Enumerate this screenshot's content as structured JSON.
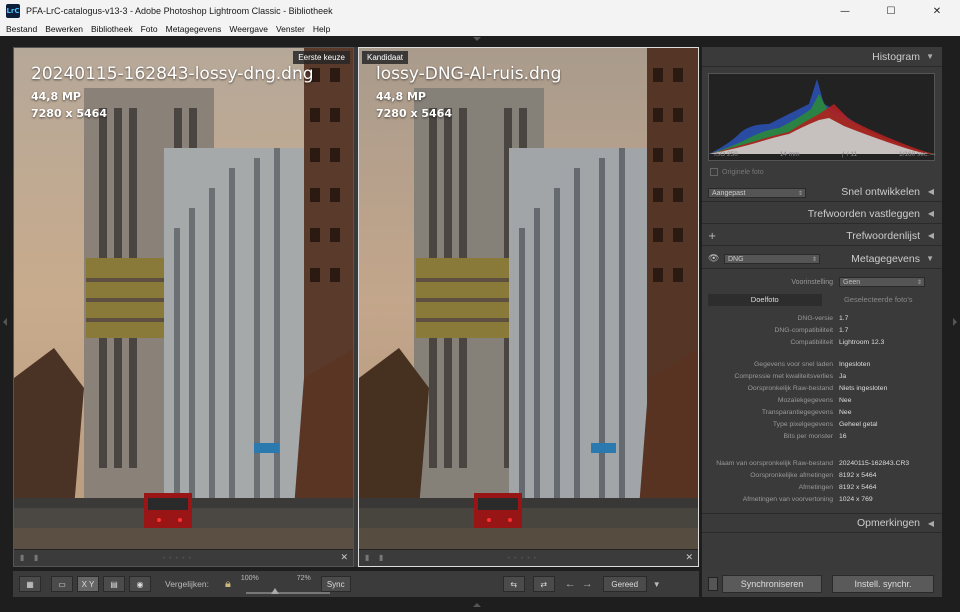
{
  "window": {
    "app_icon": "LrC",
    "title": "PFA-LrC-catalogus-v13-3 - Adobe Photoshop Lightroom Classic - Bibliotheek",
    "minimize": "—",
    "maximize": "☐",
    "close": "✕"
  },
  "menu": [
    "Bestand",
    "Bewerken",
    "Bibliotheek",
    "Foto",
    "Metagegevens",
    "Weergave",
    "Venster",
    "Help"
  ],
  "compare": {
    "left": {
      "label": "Eerste keuze",
      "filename": "20240115-162843-lossy-dng.dng",
      "megapixels": "44,8 MP",
      "dimensions": "7280 x 5464"
    },
    "right": {
      "label": "Kandidaat",
      "filename": "lossy-DNG-AI-ruis.dng",
      "megapixels": "44,8 MP",
      "dimensions": "7280 x 5464"
    }
  },
  "toolbar": {
    "compare_label": "Vergelijken:",
    "zoom_min": "100%",
    "zoom_max": "72%",
    "zoom_level": 0.35,
    "sync_label": "Sync",
    "done_label": "Gereed",
    "xy_label": "X Y"
  },
  "right_panel": {
    "histogram": {
      "title": "Histogram",
      "iso": "ISO 250",
      "focal": "14 mm",
      "aperture": "ƒ / 11",
      "shutter": "1/160 sec.",
      "original_photo": "Originele foto"
    },
    "quick_develop": {
      "preset_value": "Aangepast",
      "title": "Snel ontwikkelen"
    },
    "keywords_title": "Trefwoorden vastleggen",
    "keyword_list_title": "Trefwoordenlijst",
    "metadata": {
      "title": "Metagegevens",
      "set_value": "DNG",
      "preset_label": "Voorinstelling",
      "preset_value": "Geen",
      "tab_target": "Doelfoto",
      "tab_selected": "Geselecteerde foto's",
      "rows_a": [
        {
          "k": "DNG-versie",
          "v": "1.7"
        },
        {
          "k": "DNG-compatibiliteit",
          "v": "1.7"
        },
        {
          "k": "Compatibiliteit",
          "v": "Lightroom 12.3"
        }
      ],
      "rows_b": [
        {
          "k": "Gegevens voor snel laden",
          "v": "Ingesloten"
        },
        {
          "k": "Compressie met kwaliteitsverlies",
          "v": "Ja"
        },
        {
          "k": "Oorspronkelijk Raw-bestand",
          "v": "Niets ingesloten"
        },
        {
          "k": "Mozaïekgegevens",
          "v": "Nee"
        },
        {
          "k": "Transparantiegegevens",
          "v": "Nee"
        },
        {
          "k": "Type pixelgegevens",
          "v": "Geheel getal"
        },
        {
          "k": "Bits per monster",
          "v": "16"
        }
      ],
      "rows_c": [
        {
          "k": "Naam van oorspronkelijk Raw-bestand",
          "v": "20240115-162843.CR3"
        },
        {
          "k": "Oorspronkelijke afmetingen",
          "v": "8192 x 5464"
        },
        {
          "k": "Afmetingen",
          "v": "8192 x 5464"
        },
        {
          "k": "Afmetingen van voorvertoning",
          "v": "1024 x 769"
        }
      ]
    },
    "comments_title": "Opmerkingen",
    "sync_button": "Synchroniseren",
    "sync_settings_button": "Instell. synchr."
  }
}
